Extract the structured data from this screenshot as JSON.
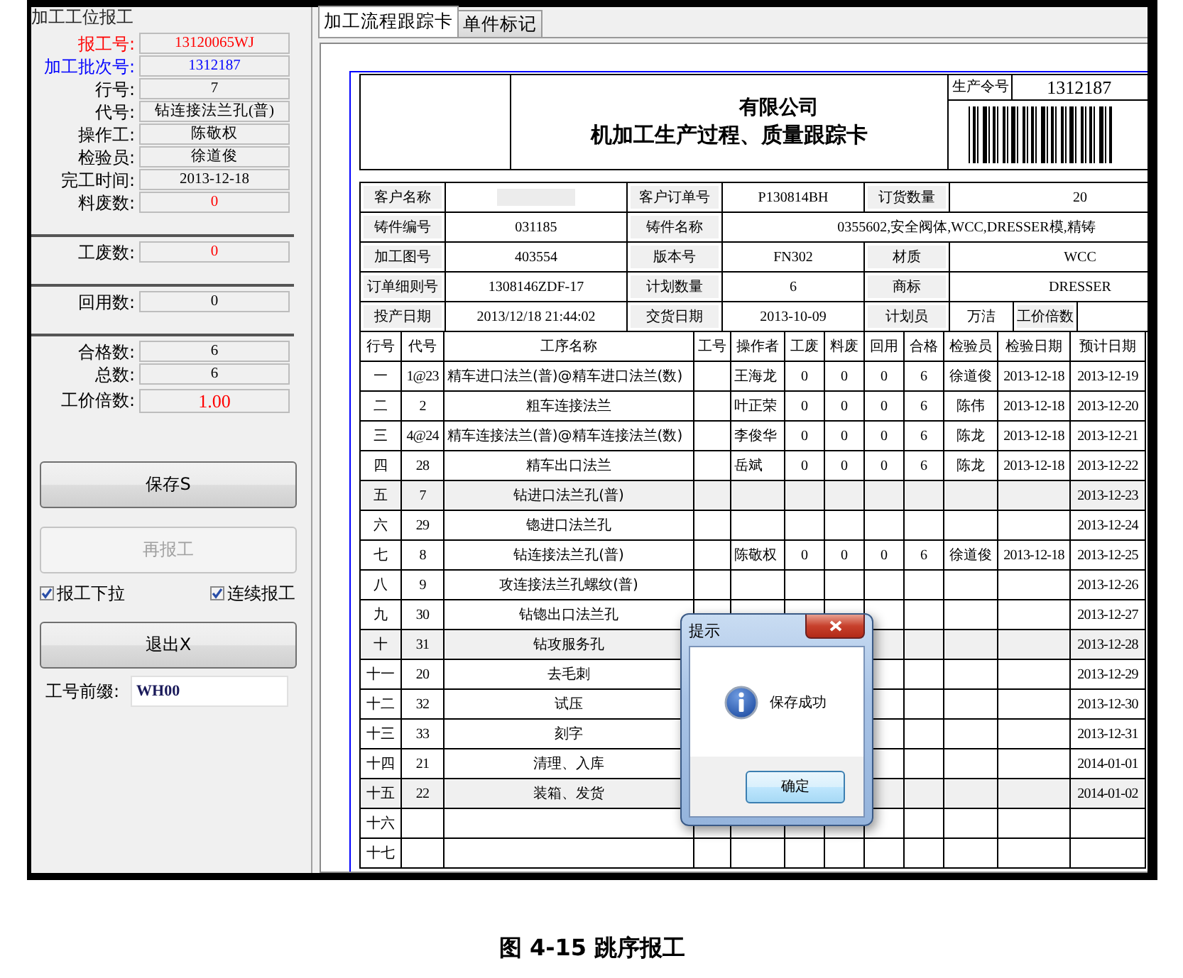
{
  "left_panel": {
    "title": "加工工位报工",
    "field_groups": [
      [
        {
          "label": {
            "text": "报工号:",
            "color": "#ff0000"
          },
          "value": {
            "text": "13120065WJ",
            "color": "#ff0000"
          }
        },
        {
          "label": {
            "text": "加工批次号:",
            "color": "#0000ff"
          },
          "value": {
            "text": "1312187",
            "color": "#0000ff"
          }
        },
        {
          "label": {
            "text": "行号:",
            "color": "#000000"
          },
          "value": {
            "text": "7",
            "color": "#000000"
          }
        },
        {
          "label": {
            "text": "代号:",
            "color": "#000000"
          },
          "value": {
            "text": "钻连接法兰孔(普)",
            "color": "#000000"
          }
        },
        {
          "label": {
            "text": "操作工:",
            "color": "#000000"
          },
          "value": {
            "text": "陈敬权",
            "color": "#000000"
          }
        },
        {
          "label": {
            "text": "检验员:",
            "color": "#000000"
          },
          "value": {
            "text": "徐道俊",
            "color": "#000000"
          }
        },
        {
          "label": {
            "text": "完工时间:",
            "color": "#000000"
          },
          "value": {
            "text": "2013-12-18",
            "color": "#000000"
          }
        },
        {
          "label": {
            "text": "料废数:",
            "color": "#000000"
          },
          "value": {
            "text": "0",
            "color": "#ff0000"
          }
        }
      ],
      [
        {
          "label": {
            "text": "工废数:",
            "color": "#000000"
          },
          "value": {
            "text": "0",
            "color": "#ff0000"
          }
        }
      ],
      [
        {
          "label": {
            "text": "回用数:",
            "color": "#000000"
          },
          "value": {
            "text": "0",
            "color": "#000000"
          }
        }
      ],
      [
        {
          "label": {
            "text": "合格数:",
            "color": "#000000"
          },
          "value": {
            "text": "6",
            "color": "#000000"
          }
        },
        {
          "label": {
            "text": "总数:",
            "color": "#000000"
          },
          "value": {
            "text": "6",
            "color": "#000000"
          }
        },
        {
          "label": {
            "text": "工价倍数:",
            "color": "#000000"
          },
          "value": {
            "text": "1.00",
            "color": "#ff0000"
          }
        }
      ]
    ],
    "buttons": [
      {
        "label": "保存S",
        "disabled": false
      },
      {
        "label": "再报工",
        "disabled": true
      }
    ],
    "checkboxes": [
      {
        "label": "报工下拉",
        "checked": true
      },
      {
        "label": "连续报工",
        "checked": true
      }
    ],
    "exit_button": {
      "label": "退出X",
      "disabled": false
    },
    "prefix": {
      "label": "工号前缀:",
      "value": "WH00"
    }
  },
  "tabs": [
    {
      "label": "加工流程跟踪卡",
      "selected": true
    },
    {
      "label": "单件标记",
      "selected": false
    }
  ],
  "card": {
    "company": "有限公司",
    "title": "机加工生产过程、质量跟踪卡",
    "order_label": "生产令号",
    "order_no": "1312187",
    "info_rows": [
      [
        {
          "kind": "label",
          "text": "客户名称"
        },
        {
          "kind": "redacted"
        },
        {
          "kind": "label",
          "text": "客户订单号"
        },
        {
          "kind": "value",
          "text": "P130814BH"
        },
        {
          "kind": "label",
          "text": "订货数量"
        },
        {
          "kind": "value",
          "text": "20"
        }
      ],
      [
        {
          "kind": "label",
          "text": "铸件编号"
        },
        {
          "kind": "value",
          "text": "031185"
        },
        {
          "kind": "label",
          "text": "铸件名称"
        },
        {
          "kind": "value",
          "text": "0355602,安全阀体,WCC,DRESSER模,精铸"
        }
      ],
      [
        {
          "kind": "label",
          "text": "加工图号"
        },
        {
          "kind": "value",
          "text": "403554"
        },
        {
          "kind": "label",
          "text": "版本号"
        },
        {
          "kind": "value",
          "text": "FN302"
        },
        {
          "kind": "label",
          "text": "材质"
        },
        {
          "kind": "value",
          "text": "WCC"
        }
      ],
      [
        {
          "kind": "label",
          "text": "订单细则号"
        },
        {
          "kind": "value",
          "text": "1308146ZDF-17"
        },
        {
          "kind": "label",
          "text": "计划数量"
        },
        {
          "kind": "value",
          "text": "6"
        },
        {
          "kind": "label",
          "text": "商标"
        },
        {
          "kind": "value",
          "text": "DRESSER"
        }
      ],
      [
        {
          "kind": "label",
          "text": "投产日期"
        },
        {
          "kind": "value",
          "text": "2013/12/18 21:44:02"
        },
        {
          "kind": "label",
          "text": "交货日期"
        },
        {
          "kind": "value",
          "text": "2013-10-09"
        },
        {
          "kind": "label",
          "text": "计划员"
        },
        {
          "kind": "value",
          "text": "万洁"
        },
        {
          "kind": "label",
          "text": "工价倍数"
        },
        {
          "kind": "value"
        }
      ]
    ],
    "process_table": {
      "columns": [
        "行号",
        "代号",
        "工序名称",
        "工号",
        "操作者",
        "工废",
        "料废",
        "回用",
        "合格",
        "检验员",
        "检验日期",
        "预计日期"
      ],
      "rows": [
        {
          "shaded": false,
          "no": "一",
          "code": "1@23",
          "name": "精车进口法兰(普)@精车进口法兰(数)",
          "operator": "王海龙",
          "work_scrap": "0",
          "material_scrap": "0",
          "reuse": "0",
          "passed": "6",
          "inspector": "徐道俊",
          "inspect_date": "2013-12-18",
          "due_date": "2013-12-19"
        },
        {
          "shaded": false,
          "no": "二",
          "code": "2",
          "name": "粗车连接法兰",
          "operator": "叶正荣",
          "work_scrap": "0",
          "material_scrap": "0",
          "reuse": "0",
          "passed": "6",
          "inspector": "陈伟",
          "inspect_date": "2013-12-18",
          "due_date": "2013-12-20"
        },
        {
          "shaded": false,
          "no": "三",
          "code": "4@24",
          "name": "精车连接法兰(普)@精车连接法兰(数)",
          "operator": "李俊华",
          "work_scrap": "0",
          "material_scrap": "0",
          "reuse": "0",
          "passed": "6",
          "inspector": "陈龙",
          "inspect_date": "2013-12-18",
          "due_date": "2013-12-21"
        },
        {
          "shaded": false,
          "no": "四",
          "code": "28",
          "name": "精车出口法兰",
          "operator": "岳斌",
          "work_scrap": "0",
          "material_scrap": "0",
          "reuse": "0",
          "passed": "6",
          "inspector": "陈龙",
          "inspect_date": "2013-12-18",
          "due_date": "2013-12-22"
        },
        {
          "shaded": true,
          "no": "五",
          "code": "7",
          "name": "钻进口法兰孔(普)",
          "due_date": "2013-12-23"
        },
        {
          "shaded": false,
          "no": "六",
          "code": "29",
          "name": "锪进口法兰孔",
          "due_date": "2013-12-24"
        },
        {
          "shaded": false,
          "no": "七",
          "code": "8",
          "name": "钻连接法兰孔(普)",
          "operator": "陈敬权",
          "work_scrap": "0",
          "material_scrap": "0",
          "reuse": "0",
          "passed": "6",
          "inspector": "徐道俊",
          "inspect_date": "2013-12-18",
          "due_date": "2013-12-25"
        },
        {
          "shaded": false,
          "no": "八",
          "code": "9",
          "name": "攻连接法兰孔螺纹(普)",
          "due_date": "2013-12-26"
        },
        {
          "shaded": false,
          "no": "九",
          "code": "30",
          "name": "钻锪出口法兰孔",
          "due_date": "2013-12-27"
        },
        {
          "shaded": true,
          "no": "十",
          "code": "31",
          "name": "钻攻服务孔",
          "due_date": "2013-12-28"
        },
        {
          "shaded": false,
          "no": "十一",
          "code": "20",
          "name": "去毛刺",
          "due_date": "2013-12-29"
        },
        {
          "shaded": false,
          "no": "十二",
          "code": "32",
          "name": "试压",
          "due_date": "2013-12-30"
        },
        {
          "shaded": false,
          "no": "十三",
          "code": "33",
          "name": "刻字",
          "due_date": "2013-12-31"
        },
        {
          "shaded": false,
          "no": "十四",
          "code": "21",
          "name": "清理、入库",
          "due_date": "2014-01-01"
        },
        {
          "shaded": true,
          "no": "十五",
          "code": "22",
          "name": "装箱、发货",
          "due_date": "2014-01-02"
        },
        {
          "shaded": false,
          "no": "十六"
        },
        {
          "shaded": false,
          "no": "十七"
        }
      ]
    }
  },
  "dialog": {
    "title": "提示",
    "message": "保存成功",
    "button": "确定"
  },
  "caption": "图 4-15 跳序报工"
}
